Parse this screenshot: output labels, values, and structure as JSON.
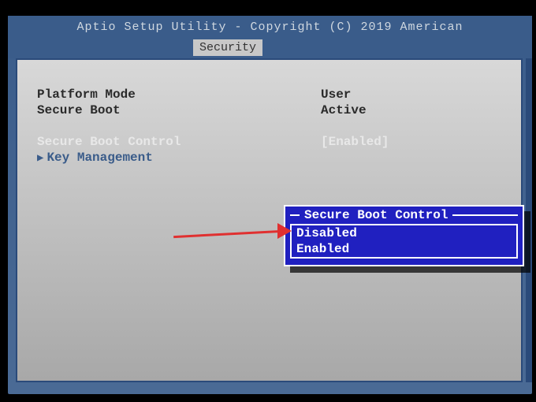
{
  "header": {
    "title": "Aptio Setup Utility - Copyright (C) 2019 American",
    "active_tab": "Security"
  },
  "info": {
    "platform_mode_label": "Platform Mode",
    "platform_mode_value": "User",
    "secure_boot_label": "Secure Boot",
    "secure_boot_value": "Active"
  },
  "menu": {
    "secure_boot_control_label": "Secure Boot Control",
    "secure_boot_control_value": "[Enabled]",
    "key_management_label": "Key Management"
  },
  "popup": {
    "title": "Secure Boot Control",
    "options": [
      "Disabled",
      "Enabled"
    ]
  }
}
